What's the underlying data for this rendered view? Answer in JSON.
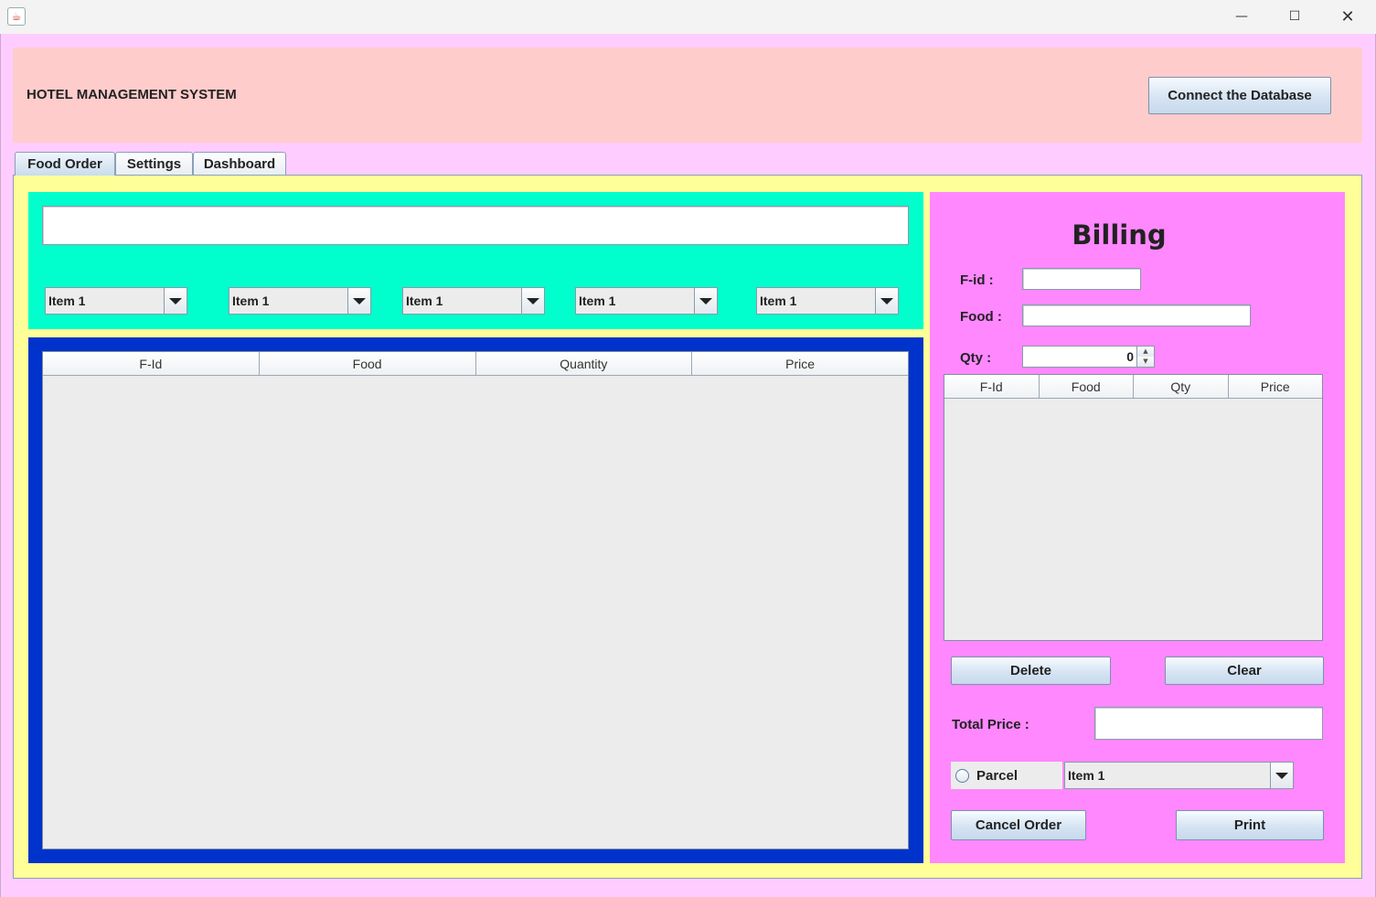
{
  "window": {
    "title": "",
    "icon": "java-cup-icon"
  },
  "header": {
    "title": "HOTEL MANAGEMENT SYSTEM",
    "connect_label": "Connect the Database"
  },
  "tabs": [
    {
      "label": "Food Order",
      "active": true
    },
    {
      "label": "Settings",
      "active": false
    },
    {
      "label": "Dashboard",
      "active": false
    }
  ],
  "search": {
    "value": ""
  },
  "category_combos": [
    {
      "selected": "Item 1"
    },
    {
      "selected": "Item 1"
    },
    {
      "selected": "Item 1"
    },
    {
      "selected": "Item 1"
    },
    {
      "selected": "Item 1"
    }
  ],
  "order_table": {
    "columns": [
      "F-Id",
      "Food",
      "Quantity",
      "Price"
    ],
    "rows": []
  },
  "billing": {
    "title": "Billing",
    "fid_label": "F-id :",
    "fid_value": "",
    "food_label": "Food :",
    "food_value": "",
    "qty_label": "Qty :",
    "qty_value": "0",
    "table": {
      "columns": [
        "F-Id",
        "Food",
        "Qty",
        "Price"
      ],
      "rows": []
    },
    "delete_label": "Delete",
    "clear_label": "Clear",
    "total_label": "Total Price :",
    "total_value": "",
    "parcel_label": "Parcel",
    "parcel_checked": false,
    "parcel_combo": "Item 1",
    "cancel_label": "Cancel Order",
    "print_label": "Print"
  },
  "colors": {
    "frame_bg": "#ffccff",
    "header_bg": "#ffcccc",
    "content_bg": "#ffff99",
    "items_panel_bg": "#00ffcc",
    "order_panel_bg": "#0033cc",
    "billing_panel_bg": "#ff88ff"
  }
}
